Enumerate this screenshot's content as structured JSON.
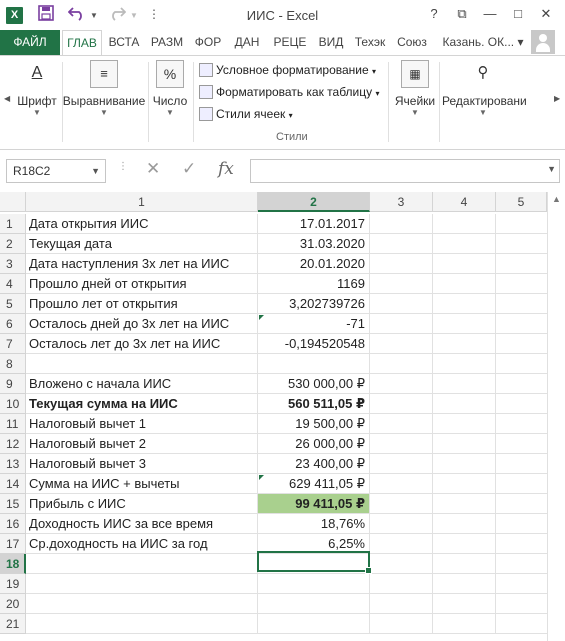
{
  "window": {
    "title": "ИИС - Excel",
    "logo": "X",
    "help": "?",
    "restore": "⧉",
    "minimize": "—",
    "maximize": "□",
    "close": "✕"
  },
  "quick_access": {
    "save_icon": "floppy-disk",
    "undo_icon": "undo-arrow",
    "redo_icon": "redo-arrow",
    "customize": "⋮"
  },
  "tabs": [
    {
      "label": "ФАЙЛ"
    },
    {
      "label": "ГЛАВ"
    },
    {
      "label": "ВСТА"
    },
    {
      "label": "РАЗМ"
    },
    {
      "label": "ФОР"
    },
    {
      "label": "ДАН"
    },
    {
      "label": "РЕЦЕ"
    },
    {
      "label": "ВИД"
    },
    {
      "label": "Техэк"
    },
    {
      "label": "Союз"
    }
  ],
  "account": {
    "name": "Казань. ОК..."
  },
  "ribbon": {
    "font_label": "Шрифт",
    "align_label": "Выравнивание",
    "number_label": "Число",
    "cond_format": "Условное форматирование",
    "format_table": "Форматировать как таблицу",
    "cell_styles": "Стили ячеек",
    "styles_group": "Стили",
    "cells_label": "Ячейки",
    "editing_label": "Редактировани",
    "number_icon": "%"
  },
  "formula_bar": {
    "name_box": "R18C2",
    "cancel": "✕",
    "enter": "✓",
    "fx": "fx",
    "value": ""
  },
  "columns": [
    {
      "label": "1"
    },
    {
      "label": "2"
    },
    {
      "label": "3"
    },
    {
      "label": "4"
    },
    {
      "label": "5"
    }
  ],
  "rows": [
    {
      "num": "1",
      "a": "Дата открытия ИИС",
      "b": "17.01.2017"
    },
    {
      "num": "2",
      "a": "Текущая дата",
      "b": "31.03.2020"
    },
    {
      "num": "3",
      "a": "Дата наступления 3х лет на ИИС",
      "b": "20.01.2020"
    },
    {
      "num": "4",
      "a": "Прошло дней от открытия",
      "b": "1169"
    },
    {
      "num": "5",
      "a": "Прошло лет от открытия",
      "b": "3,202739726"
    },
    {
      "num": "6",
      "a": "Осталось дней до 3х лет на ИИС",
      "b": "-71"
    },
    {
      "num": "7",
      "a": "Осталось лет до 3х лет на ИИС",
      "b": "-0,194520548"
    },
    {
      "num": "8",
      "a": "",
      "b": ""
    },
    {
      "num": "9",
      "a": "Вложено с начала ИИС",
      "b": "530 000,00 ₽"
    },
    {
      "num": "10",
      "a": "Текущая сумма на ИИС",
      "b": "560 511,05 ₽"
    },
    {
      "num": "11",
      "a": "Налоговый вычет 1",
      "b": "19 500,00 ₽"
    },
    {
      "num": "12",
      "a": "Налоговый вычет 2",
      "b": "26 000,00 ₽"
    },
    {
      "num": "13",
      "a": "Налоговый вычет 3",
      "b": "23 400,00 ₽"
    },
    {
      "num": "14",
      "a": "Сумма на ИИС + вычеты",
      "b": "629 411,05 ₽"
    },
    {
      "num": "15",
      "a": "Прибыль с ИИС",
      "b": "99 411,05 ₽"
    },
    {
      "num": "16",
      "a": "Доходность ИИС за все время",
      "b": "18,76%"
    },
    {
      "num": "17",
      "a": "Ср.доходность на ИИС за год",
      "b": "6,25%"
    },
    {
      "num": "18",
      "a": "",
      "b": ""
    },
    {
      "num": "19",
      "a": "",
      "b": ""
    },
    {
      "num": "20",
      "a": "",
      "b": ""
    },
    {
      "num": "21",
      "a": "",
      "b": ""
    }
  ],
  "colors": {
    "accent": "#217346",
    "highlight": "#a9d08e"
  }
}
